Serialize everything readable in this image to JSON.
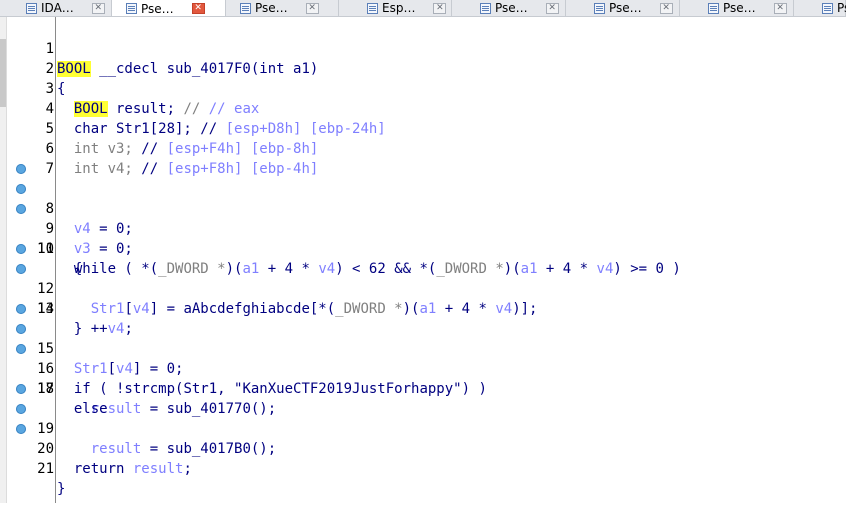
{
  "tabs": [
    {
      "label": "IDA…",
      "active": false
    },
    {
      "label": "Pse…",
      "active": true
    },
    {
      "label": "Pse…",
      "active": false
    },
    {
      "label": "Esp…",
      "active": false
    },
    {
      "label": "Pse…",
      "active": false
    },
    {
      "label": "Pse…",
      "active": false
    },
    {
      "label": "Pse…",
      "active": false
    },
    {
      "label": "Pse…",
      "active": false
    }
  ],
  "code": {
    "lines": [
      {
        "num": "1",
        "bp": false
      },
      {
        "num": "2",
        "bp": false
      },
      {
        "num": "3",
        "bp": false
      },
      {
        "num": "4",
        "bp": false
      },
      {
        "num": "5",
        "bp": false
      },
      {
        "num": "6",
        "bp": false
      },
      {
        "num": "7",
        "bp": false
      },
      {
        "num": "8",
        "bp": true
      },
      {
        "num": "9",
        "bp": true
      },
      {
        "num": "10",
        "bp": true
      },
      {
        "num": "11",
        "bp": false
      },
      {
        "num": "12",
        "bp": true
      },
      {
        "num": "13",
        "bp": true
      },
      {
        "num": "14",
        "bp": false
      },
      {
        "num": "15",
        "bp": true
      },
      {
        "num": "16",
        "bp": true
      },
      {
        "num": "17",
        "bp": true
      },
      {
        "num": "18",
        "bp": false
      },
      {
        "num": "19",
        "bp": true
      },
      {
        "num": "20",
        "bp": true
      },
      {
        "num": "21",
        "bp": true
      }
    ],
    "t": {
      "bool": "BOOL",
      "cdecl": " __cdecl ",
      "sig": "sub_4017F0(int a1)",
      "lbrace": "{",
      "rbrace": "}",
      "result_decl": " result; ",
      "c_eax": "// eax",
      "char_decl": "char Str1[28]; ",
      "c_str1_a": "// ",
      "c_str1_b": "[esp+D8h] [ebp-24h]",
      "int_v3": "int v3; ",
      "c_v3_a": "// ",
      "c_v3_b": "[esp+F4h] [ebp-8h]",
      "int_v4": "int v4; ",
      "c_v4_a": "// ",
      "c_v4_b": "[esp+F8h] [ebp-4h]",
      "v4": "v4",
      "v3": "v3",
      "a1": "a1",
      "str1": "Str1",
      "result": "result",
      "assign0": " = 0;",
      "while_kw": "while ( *(",
      "dword": "_DWORD *",
      "paren_open": ")(",
      "plus4": " + 4 * ",
      "lt62": ") < 62 && *(",
      "ge0": ") >= 0 )",
      "lb_bracket": "[",
      "eq_tbl": "] = aAbcdefghiabcde[*(",
      "close_idx": ")];",
      "incr": "++",
      "semicolon": ";",
      "if_kw": "if ( !strcmp(",
      "comma_sp": ", ",
      "str_lit": "\"KanXueCTF2019JustForhappy\"",
      "if_close": ") )",
      "eq_call1": " = sub_401770();",
      "else_kw": "else",
      "eq_call2": " = sub_4017B0();",
      "return_kw": "return ",
      "close_paren": ")"
    }
  }
}
